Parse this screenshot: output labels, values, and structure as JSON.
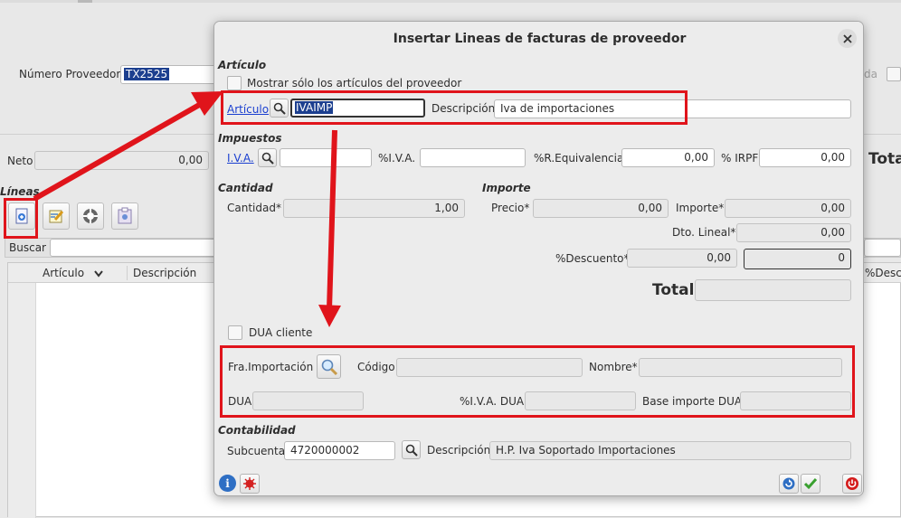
{
  "background": {
    "numero_proveedor_label": "Número Proveedor",
    "numero_proveedor_value": "TX2525",
    "right_cut_label": "da",
    "neto_label": "Neto",
    "neto_value": "0,00",
    "total_label": "Tota",
    "lineas_label": "Líneas",
    "buscar_label": "Buscar",
    "columns": [
      "Artículo",
      "Descripción"
    ],
    "right_column": "%Descue"
  },
  "dialog": {
    "title": "Insertar Lineas de facturas de proveedor",
    "articulo_section": "Artículo",
    "mostrar_checkbox_label": "Mostrar sólo los artículos del proveedor",
    "articulo_link": "Artículo",
    "articulo_value": "IVAIMP",
    "descripcion_label": "Descripción",
    "descripcion_value": "Iva de importaciones",
    "impuestos_section": "Impuestos",
    "iva_link": "I.V.A.",
    "iva_value": "",
    "pct_iva_label": "%I.V.A.",
    "pct_iva_value": "",
    "req_label": "%R.Equivalencia",
    "req_value": "0,00",
    "irpf_label": "% IRPF",
    "irpf_value": "0,00",
    "cantidad_section": "Cantidad",
    "cantidad_label": "Cantidad*",
    "cantidad_value": "1,00",
    "importe_section": "Importe",
    "precio_label": "Precio*",
    "precio_value": "0,00",
    "importe_label": "Importe*",
    "importe_value": "0,00",
    "dto_lineal_label": "Dto. Lineal*",
    "dto_lineal_value": "0,00",
    "descuento_label": "%Descuento*",
    "descuento_value": "0,00",
    "descuento_total": "0",
    "total_label": "Total",
    "total_value": "",
    "dua_checkbox_label": "DUA cliente",
    "fra_importacion_label": "Fra.Importación",
    "codigo_label": "Código",
    "codigo_value": "",
    "nombre_label": "Nombre*",
    "nombre_value": "",
    "dua_label": "DUA",
    "dua_value": "",
    "iva_dua_label": "%I.V.A. DUA",
    "iva_dua_value": "",
    "base_dua_label": "Base importe DUA",
    "base_dua_value": "",
    "contabilidad_section": "Contabilidad",
    "subcuenta_label": "Subcuenta",
    "subcuenta_value": "4720000002",
    "subcuenta_desc_label": "Descripción",
    "subcuenta_desc_value": "H.P. Iva Soportado Importaciones"
  },
  "colors": {
    "highlight_red": "#e0141b",
    "link_blue": "#1a3fd0",
    "selection_blue": "#1c3f8f"
  }
}
